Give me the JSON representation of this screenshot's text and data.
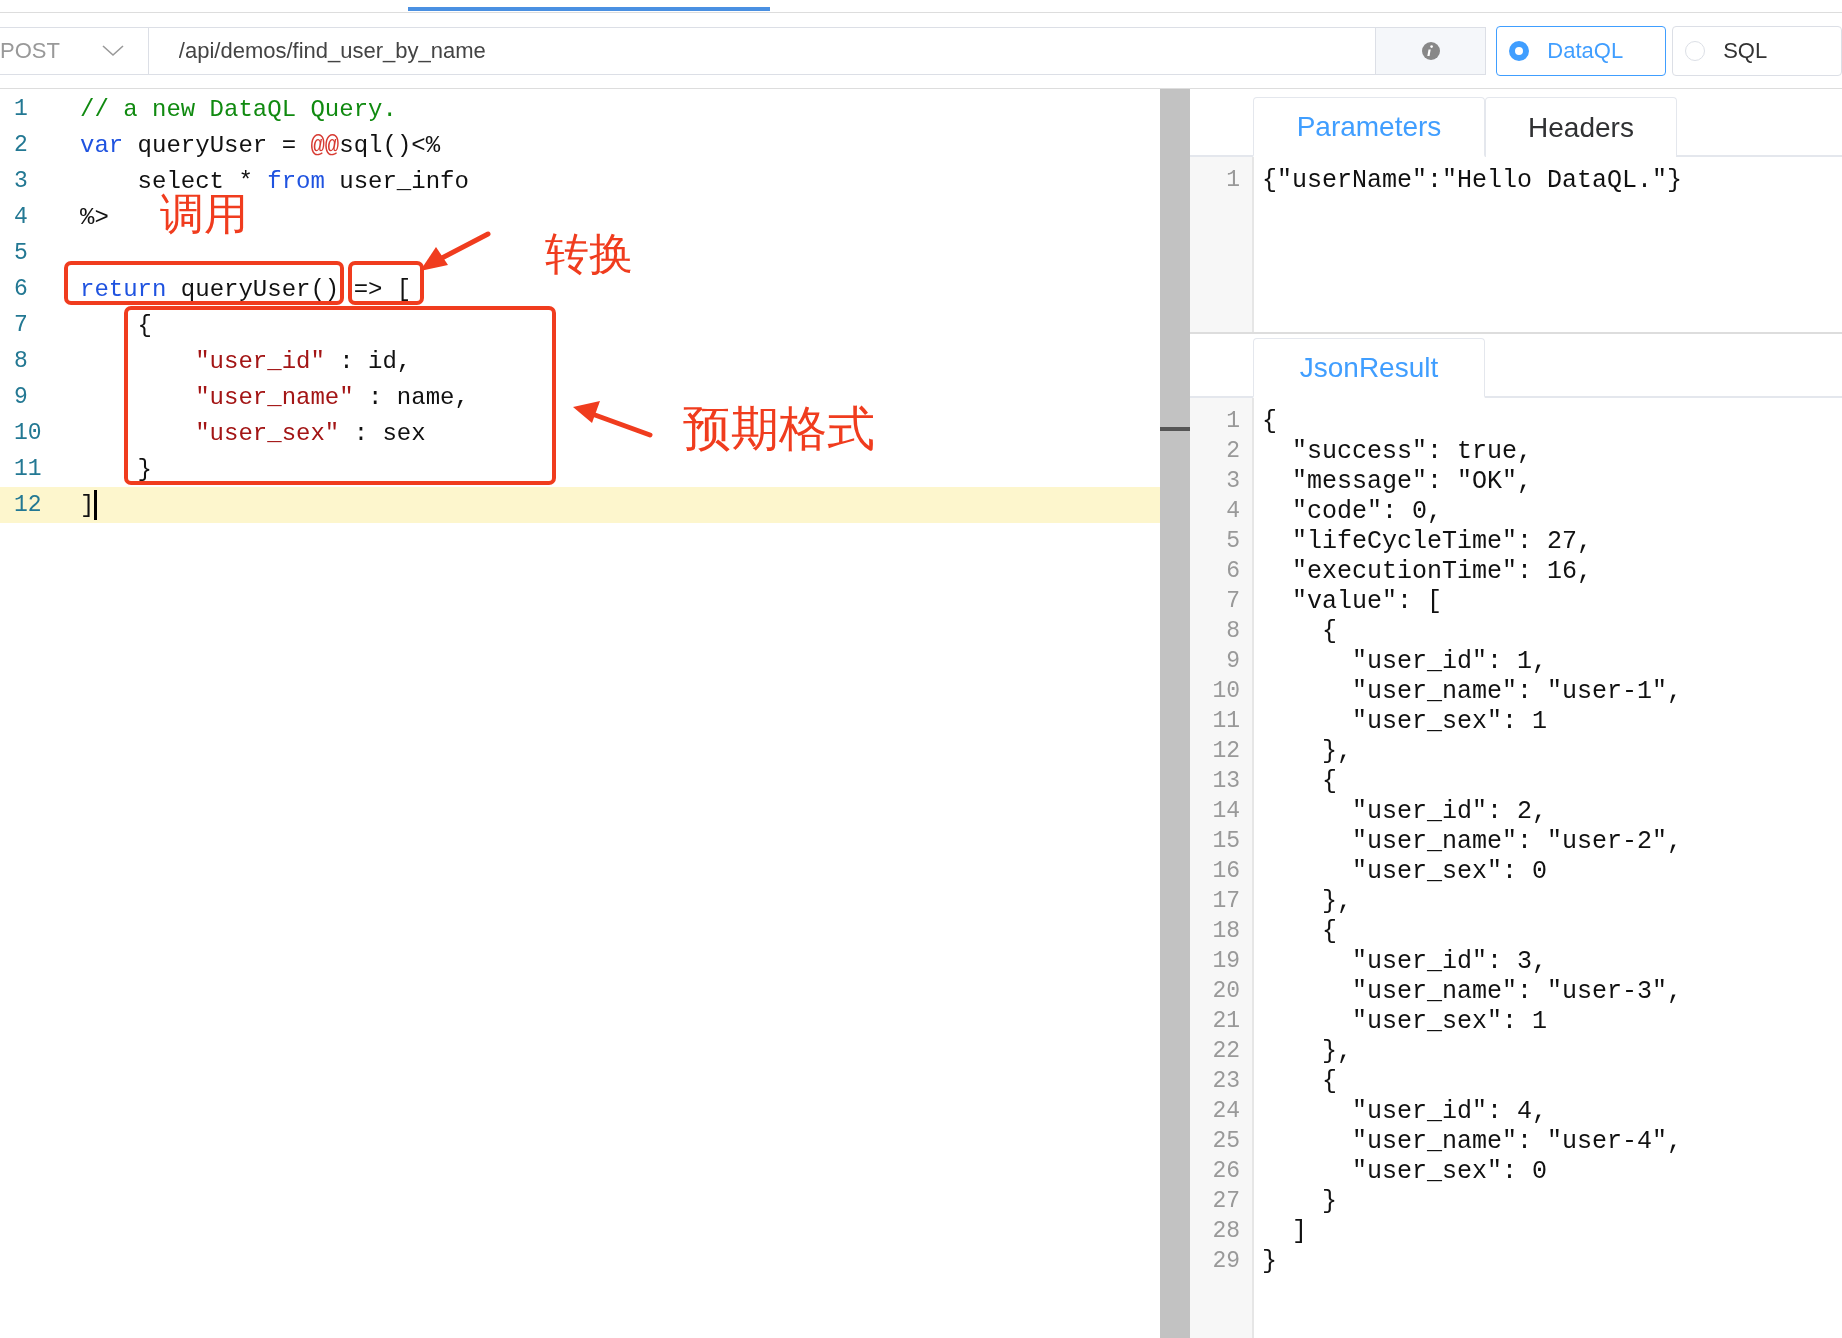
{
  "toolbar": {
    "method": "POST",
    "url": "/api/demos/find_user_by_name",
    "modes": [
      {
        "label": "DataQL",
        "selected": true
      },
      {
        "label": "SQL",
        "selected": false
      }
    ]
  },
  "editor": {
    "lines": [
      {
        "number": "1",
        "active": false,
        "tokens": [
          {
            "kind": "comment",
            "text": "// a new DataQL Query."
          }
        ]
      },
      {
        "number": "2",
        "active": false,
        "tokens": [
          {
            "kind": "keyword",
            "text": "var"
          },
          {
            "kind": "plain",
            "text": " queryUser = "
          },
          {
            "kind": "special",
            "text": "@@"
          },
          {
            "kind": "plain",
            "text": "sql()<%"
          }
        ]
      },
      {
        "number": "3",
        "active": false,
        "tokens": [
          {
            "kind": "plain",
            "text": "    select * "
          },
          {
            "kind": "keyword",
            "text": "from"
          },
          {
            "kind": "plain",
            "text": " user_info"
          }
        ]
      },
      {
        "number": "4",
        "active": false,
        "tokens": [
          {
            "kind": "plain",
            "text": "%>"
          }
        ]
      },
      {
        "number": "5",
        "active": false
      },
      {
        "number": "6",
        "active": false,
        "tokens": [
          {
            "kind": "keyword",
            "text": "return"
          },
          {
            "kind": "plain",
            "text": " queryUser()"
          },
          {
            "kind": "operator",
            "text": "=> ["
          }
        ]
      },
      {
        "number": "7",
        "active": false,
        "tokens": [
          {
            "kind": "plain",
            "text": "    {"
          }
        ]
      },
      {
        "number": "8",
        "active": false,
        "tokens": [
          {
            "kind": "string",
            "text": "        \"user_id\""
          },
          {
            "kind": "plain",
            "text": " : id,"
          }
        ]
      },
      {
        "number": "9",
        "active": false,
        "tokens": [
          {
            "kind": "string",
            "text": "        \"user_name\""
          },
          {
            "kind": "plain",
            "text": " : name,"
          }
        ]
      },
      {
        "number": "10",
        "active": false,
        "tokens": [
          {
            "kind": "string",
            "text": "        \"user_sex\""
          },
          {
            "kind": "plain",
            "text": " : sex"
          }
        ]
      },
      {
        "number": "11",
        "active": false,
        "tokens": [
          {
            "kind": "plain",
            "text": "    }"
          }
        ]
      },
      {
        "number": "12",
        "active": true,
        "tokens": [
          {
            "kind": "plain",
            "text": "]"
          }
        ]
      }
    ]
  },
  "annotations": {
    "call_label": "调用",
    "convert_label": "转换",
    "format_label": "预期格式"
  },
  "parameters_panel": {
    "tabs": [
      {
        "label": "Parameters",
        "selected": true
      },
      {
        "label": "Headers",
        "selected": false
      }
    ],
    "lines": [
      {
        "number": "1",
        "text": "{\"userName\":\"Hello DataQL.\"}"
      }
    ]
  },
  "result_panel": {
    "tabs": [
      {
        "label": "JsonResult",
        "selected": true
      }
    ],
    "lines": [
      {
        "number": "1",
        "text": "{"
      },
      {
        "number": "2",
        "text": "  \"success\": true,"
      },
      {
        "number": "3",
        "text": "  \"message\": \"OK\","
      },
      {
        "number": "4",
        "text": "  \"code\": 0,"
      },
      {
        "number": "5",
        "text": "  \"lifeCycleTime\": 27,"
      },
      {
        "number": "6",
        "text": "  \"executionTime\": 16,"
      },
      {
        "number": "7",
        "text": "  \"value\": ["
      },
      {
        "number": "8",
        "text": "    {"
      },
      {
        "number": "9",
        "text": "      \"user_id\": 1,"
      },
      {
        "number": "10",
        "text": "      \"user_name\": \"user-1\","
      },
      {
        "number": "11",
        "text": "      \"user_sex\": 1"
      },
      {
        "number": "12",
        "text": "    },"
      },
      {
        "number": "13",
        "text": "    {"
      },
      {
        "number": "14",
        "text": "      \"user_id\": 2,"
      },
      {
        "number": "15",
        "text": "      \"user_name\": \"user-2\","
      },
      {
        "number": "16",
        "text": "      \"user_sex\": 0"
      },
      {
        "number": "17",
        "text": "    },"
      },
      {
        "number": "18",
        "text": "    {"
      },
      {
        "number": "19",
        "text": "      \"user_id\": 3,"
      },
      {
        "number": "20",
        "text": "      \"user_name\": \"user-3\","
      },
      {
        "number": "21",
        "text": "      \"user_sex\": 1"
      },
      {
        "number": "22",
        "text": "    },"
      },
      {
        "number": "23",
        "text": "    {"
      },
      {
        "number": "24",
        "text": "      \"user_id\": 4,"
      },
      {
        "number": "25",
        "text": "      \"user_name\": \"user-4\","
      },
      {
        "number": "26",
        "text": "      \"user_sex\": 0"
      },
      {
        "number": "27",
        "text": "    }"
      },
      {
        "number": "28",
        "text": "  ]"
      },
      {
        "number": "29",
        "text": "}"
      }
    ]
  }
}
